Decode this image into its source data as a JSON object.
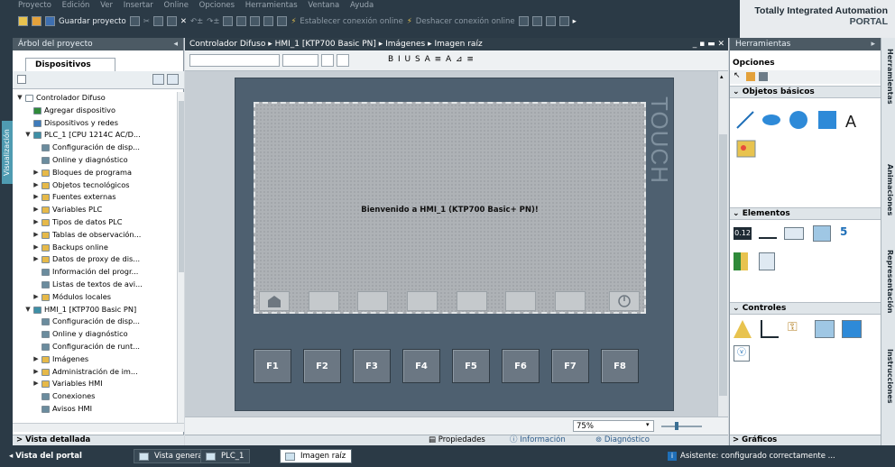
{
  "menu": [
    "Proyecto",
    "Edición",
    "Ver",
    "Insertar",
    "Online",
    "Opciones",
    "Herramientas",
    "Ventana",
    "Ayuda"
  ],
  "toolbar": {
    "save_label": "Guardar proyecto",
    "go_online": "Establecer conexión online",
    "go_offline": "Deshacer conexión online"
  },
  "brand": {
    "line1": "Totally Integrated Automation",
    "line2": "PORTAL"
  },
  "left_vtab": "Visualización",
  "project_tree": {
    "title": "Árbol del proyecto",
    "tab": "Dispositivos",
    "items": [
      {
        "label": "Controlador Difuso",
        "level": 0,
        "arrow": "▼",
        "color": "#ffffff"
      },
      {
        "label": "Agregar dispositivo",
        "level": 1,
        "arrow": "",
        "color": "#2f8a3a"
      },
      {
        "label": "Dispositivos y redes",
        "level": 1,
        "arrow": "",
        "color": "#3e7bbb"
      },
      {
        "label": "PLC_1 [CPU 1214C AC/D...",
        "level": 1,
        "arrow": "▼",
        "color": "#3e8fa6"
      },
      {
        "label": "Configuración de disp...",
        "level": 2,
        "arrow": "",
        "color": "#6b8c9e"
      },
      {
        "label": "Online y diagnóstico",
        "level": 2,
        "arrow": "",
        "color": "#6b8c9e"
      },
      {
        "label": "Bloques de programa",
        "level": 2,
        "arrow": "▶",
        "color": "#e6b949"
      },
      {
        "label": "Objetos tecnológicos",
        "level": 2,
        "arrow": "▶",
        "color": "#e6b949"
      },
      {
        "label": "Fuentes externas",
        "level": 2,
        "arrow": "▶",
        "color": "#e6b949"
      },
      {
        "label": "Variables PLC",
        "level": 2,
        "arrow": "▶",
        "color": "#e6b949"
      },
      {
        "label": "Tipos de datos PLC",
        "level": 2,
        "arrow": "▶",
        "color": "#e6b949"
      },
      {
        "label": "Tablas de observación...",
        "level": 2,
        "arrow": "▶",
        "color": "#e6b949"
      },
      {
        "label": "Backups online",
        "level": 2,
        "arrow": "▶",
        "color": "#e6b949"
      },
      {
        "label": "Datos de proxy de dis...",
        "level": 2,
        "arrow": "▶",
        "color": "#e6b949"
      },
      {
        "label": "Información del progr...",
        "level": 2,
        "arrow": "",
        "color": "#6b8c9e"
      },
      {
        "label": "Listas de textos de avi...",
        "level": 2,
        "arrow": "",
        "color": "#6b8c9e"
      },
      {
        "label": "Módulos locales",
        "level": 2,
        "arrow": "▶",
        "color": "#e6b949"
      },
      {
        "label": "HMI_1 [KTP700 Basic PN]",
        "level": 1,
        "arrow": "▼",
        "color": "#3e8fa6"
      },
      {
        "label": "Configuración de disp...",
        "level": 2,
        "arrow": "",
        "color": "#6b8c9e"
      },
      {
        "label": "Online y diagnóstico",
        "level": 2,
        "arrow": "",
        "color": "#6b8c9e"
      },
      {
        "label": "Configuración de runt...",
        "level": 2,
        "arrow": "",
        "color": "#6b8c9e"
      },
      {
        "label": "Imágenes",
        "level": 2,
        "arrow": "▶",
        "color": "#e6b949"
      },
      {
        "label": "Administración de im...",
        "level": 2,
        "arrow": "▶",
        "color": "#e6b949"
      },
      {
        "label": "Variables HMI",
        "level": 2,
        "arrow": "▶",
        "color": "#e6b949"
      },
      {
        "label": "Conexiones",
        "level": 2,
        "arrow": "",
        "color": "#6b8c9e"
      },
      {
        "label": "Avisos HMI",
        "level": 2,
        "arrow": "",
        "color": "#6b8c9e"
      }
    ]
  },
  "editor": {
    "breadcrumb": "Controlador Difuso  ▸  HMI_1 [KTP700 Basic PN]  ▸  Imágenes  ▸  Imagen raíz",
    "format_icons": "B  I  U  S  A  ≡  A  ⊿  ≡",
    "welcome": "Bienvenido a HMI_1 (KTP700 Basic+ PN)!",
    "touch": "TOUCH",
    "fkeys": [
      "F1",
      "F2",
      "F3",
      "F4",
      "F5",
      "F6",
      "F7",
      "F8"
    ],
    "zoom": "75%"
  },
  "tools": {
    "title": "Herramientas",
    "options": "Opciones",
    "sections": {
      "basic": "Objetos básicos",
      "elements": "Elementos",
      "controls": "Controles",
      "graphics": "Gráficos"
    },
    "basic_text": "A",
    "element_labels": {
      "io": "0.12",
      "clock": "5"
    }
  },
  "right_vtabs": [
    "Herramientas",
    "Animaciones",
    "Representación",
    "Instrucciones"
  ],
  "bottom_tabs": {
    "detail": "Vista detallada",
    "properties": "Propiedades",
    "info": "Información",
    "diagnostics": "Diagnóstico"
  },
  "status": {
    "portal_view": "Vista del portal",
    "overview": "Vista general",
    "plc": "PLC_1",
    "root": "Imagen raíz",
    "message": "Asistente: configurado correctamente ..."
  }
}
